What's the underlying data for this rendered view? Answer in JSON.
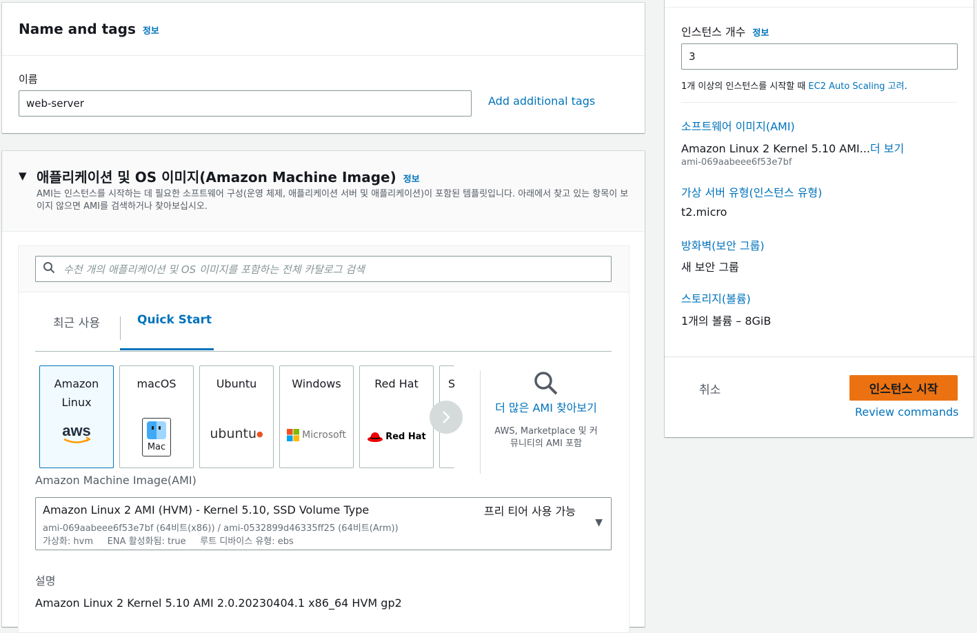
{
  "name_tags": {
    "title": "Name and tags",
    "info": "정보",
    "name_label": "이름",
    "name_value": "web-server",
    "add_tags": "Add additional tags"
  },
  "ami": {
    "title": "애플리케이션 및 OS 이미지(Amazon Machine Image)",
    "info": "정보",
    "description": "AMI는 인스턴스를 시작하는 데 필요한 소프트웨어 구성(운영 체제, 애플리케이션 서버 및 애플리케이션)이 포함된 템플릿입니다. 아래에서 찾고 있는 항목이 보이지 않으면 AMI를 검색하거나 찾아보십시오.",
    "search_placeholder": "수천 개의 애플리케이션 및 OS 이미지를 포함하는 전체 카탈로그 검색",
    "tabs": [
      "최근 사용",
      "Quick Start"
    ],
    "active_tab": "Quick Start",
    "os_options": [
      {
        "name": "Amazon Linux",
        "logo": "aws-logo",
        "selected": true
      },
      {
        "name": "macOS",
        "logo": "mac-logo",
        "logo_text": "Mac"
      },
      {
        "name": "Ubuntu",
        "logo": "ubuntu-logo",
        "logo_text": "ubuntu"
      },
      {
        "name": "Windows",
        "logo": "microsoft-logo",
        "logo_text": "Microsoft"
      },
      {
        "name": "Red Hat",
        "logo": "redhat-logo",
        "logo_text": "Red Hat"
      },
      {
        "name": "S"
      }
    ],
    "browse_more": "더 많은 AMI 찾아보기",
    "browse_more_sub": "AWS, Marketplace 및 커뮤니티의 AMI 포함",
    "ami_label": "Amazon Machine Image(AMI)",
    "selected_ami": {
      "name": "Amazon Linux 2 AMI (HVM) - Kernel 5.10, SSD Volume Type",
      "free_tier": "프리 티어 사용 가능",
      "ids": "ami-069aabeee6f53e7bf (64비트(x86)) / ami-0532899d46335ff25 (64비트(Arm))",
      "meta": "가상화: hvm     ENA 활성화됨: true     루트 디바이스 유형: ebs"
    },
    "desc_label": "설명",
    "desc_value": "Amazon Linux 2 Kernel 5.10 AMI 2.0.20230404.1 x86_64 HVM gp2"
  },
  "summary": {
    "instances_label": "인스턴스 개수",
    "info": "정보",
    "instances_value": "3",
    "note_prefix": "1개 이상의 인스턴스를 시작할 때 ",
    "note_link": "EC2 Auto Scaling 고려",
    "note_suffix": ".",
    "software_label": "소프트웨어 이미지(AMI)",
    "software_value": "Amazon Linux 2 Kernel 5.10 AMI...",
    "software_more": "더 보기",
    "software_id": "ami-069aabeee6f53e7bf",
    "type_label": "가상 서버 유형(인스턴스 유형)",
    "type_value": "t2.micro",
    "fw_label": "방화벽(보안 그룹)",
    "fw_value": "새 보안 그룹",
    "storage_label": "스토리지(볼륨)",
    "storage_value": "1개의 볼륨 – 8GiB"
  },
  "actions": {
    "cancel": "취소",
    "launch": "인스턴스 시작",
    "review": "Review commands"
  },
  "colors": {
    "accent": "#0073bb",
    "primary_button": "#ec7211"
  }
}
